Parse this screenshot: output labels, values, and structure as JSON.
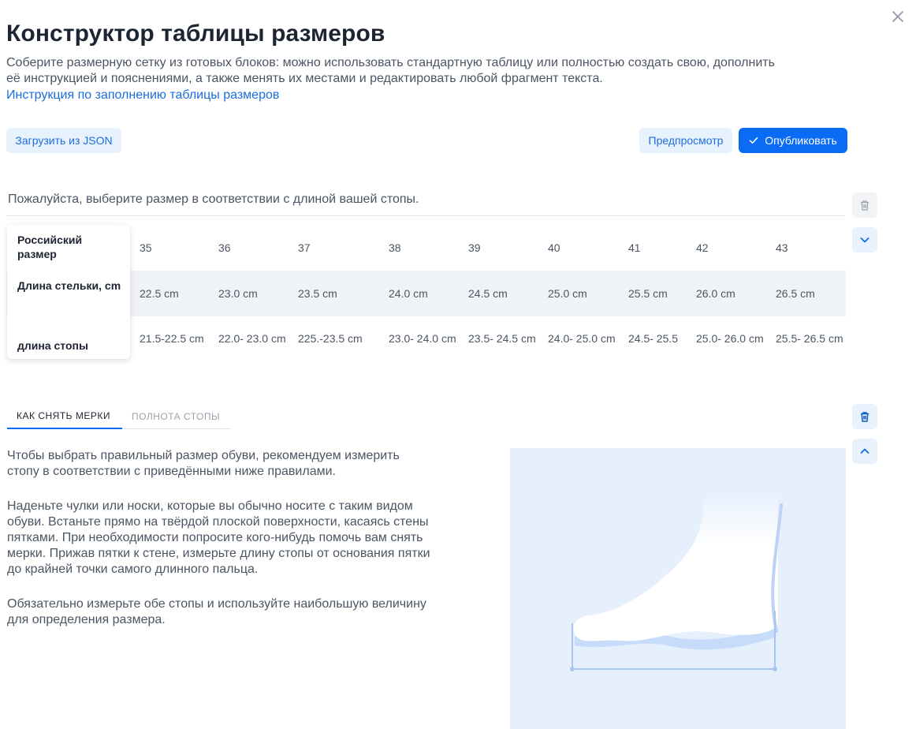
{
  "header": {
    "title": "Конструктор таблицы размеров",
    "intro_lines": [
      "Соберите размерную сетку из готовых блоков: можно использовать стандартную таблицу или полностью создать свою, дополнить",
      "её инструкцией и пояснениями, а также менять их местами и редактировать любой фрагмент текста."
    ],
    "guide_link": "Инструкция по заполнению таблицы размеров"
  },
  "toolbar": {
    "upload_label": "Загрузить из JSON",
    "preview_label": "Предпросмотр",
    "publish_label": "Опубликовать"
  },
  "size_table": {
    "note": "Пожалуйста, выберите размер в соответствии с длиной вашей стопы.",
    "rows": [
      {
        "label": "Российский размер",
        "cells": [
          "35",
          "36",
          "37",
          "38",
          "39",
          "40",
          "41",
          "42",
          "43"
        ]
      },
      {
        "label": "Длина стельки, cm",
        "cells": [
          "22.5 cm",
          "23.0 cm",
          "23.5 cm",
          "24.0 cm",
          "24.5 cm",
          "25.0 cm",
          "25.5 cm",
          "26.0 cm",
          "26.5 cm"
        ]
      },
      {
        "label": "длина стопы",
        "cells": [
          "21.5-22.5 cm",
          "22.0- 23.0 cm",
          "225.-23.5 cm",
          "23.0- 24.0 cm",
          "23.5- 24.5 cm",
          "24.0- 25.0 cm",
          "24.5- 25.5",
          "25.0- 26.0 cm",
          "25.5- 26.5 cm"
        ]
      }
    ]
  },
  "tabs": [
    {
      "label": "КАК СНЯТЬ МЕРКИ",
      "active": true
    },
    {
      "label": "ПОЛНОТА СТОПЫ",
      "active": false
    }
  ],
  "instructions": {
    "paragraphs": [
      [
        "Чтобы выбрать правильный размер обуви, рекомендуем измерить",
        "стопу в соответствии с приведёнными ниже правилами."
      ],
      [
        "Наденьте чулки или носки, которые вы обычно носите с таким видом",
        "обуви. Встаньте прямо на твёрдой плоской поверхности, касаясь стены",
        "пятками. При необходимости попросите кого-нибудь помочь вам снять",
        "мерки. Прижав пятки к стене, измерьте длину стопы от основания пятки",
        "до крайней точки самого длинного пальца."
      ],
      [
        "Обязательно измерьте обе стопы и используйте наибольшую величину",
        "для определения размера."
      ]
    ]
  },
  "icons": {
    "close": "close-icon",
    "trash": "trash-icon",
    "chevron_down": "chevron-down-icon",
    "chevron_up": "chevron-up-icon",
    "check": "check-icon",
    "foot_illustration": "foot-measurement-illustration"
  },
  "colors": {
    "accent": "#0a6cf5",
    "link": "#1a6ee0",
    "light_button": "#e8f2fc",
    "illustration_bg": "#e6f0fd"
  }
}
